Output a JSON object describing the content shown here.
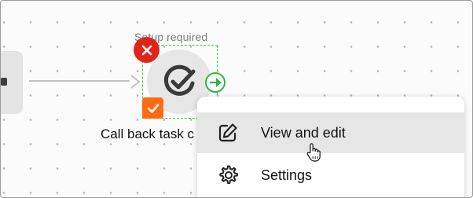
{
  "canvas": {
    "previous_node": {},
    "node": {
      "status_label": "Setup required",
      "title": "Call back task c",
      "icon": "check-circle-icon"
    },
    "badges": {
      "delete_icon": "close-icon",
      "run_icon": "play-circle-icon",
      "checkbox_icon": "checkmark-icon"
    }
  },
  "context_menu": {
    "items": [
      {
        "label": "View and edit",
        "icon": "edit-icon",
        "hovered": true
      },
      {
        "label": "Settings",
        "icon": "gear-icon",
        "hovered": false
      }
    ]
  },
  "colors": {
    "accent_green": "#33cc33",
    "delete_red": "#e2231a",
    "checkbox_orange": "#ff6a13"
  }
}
